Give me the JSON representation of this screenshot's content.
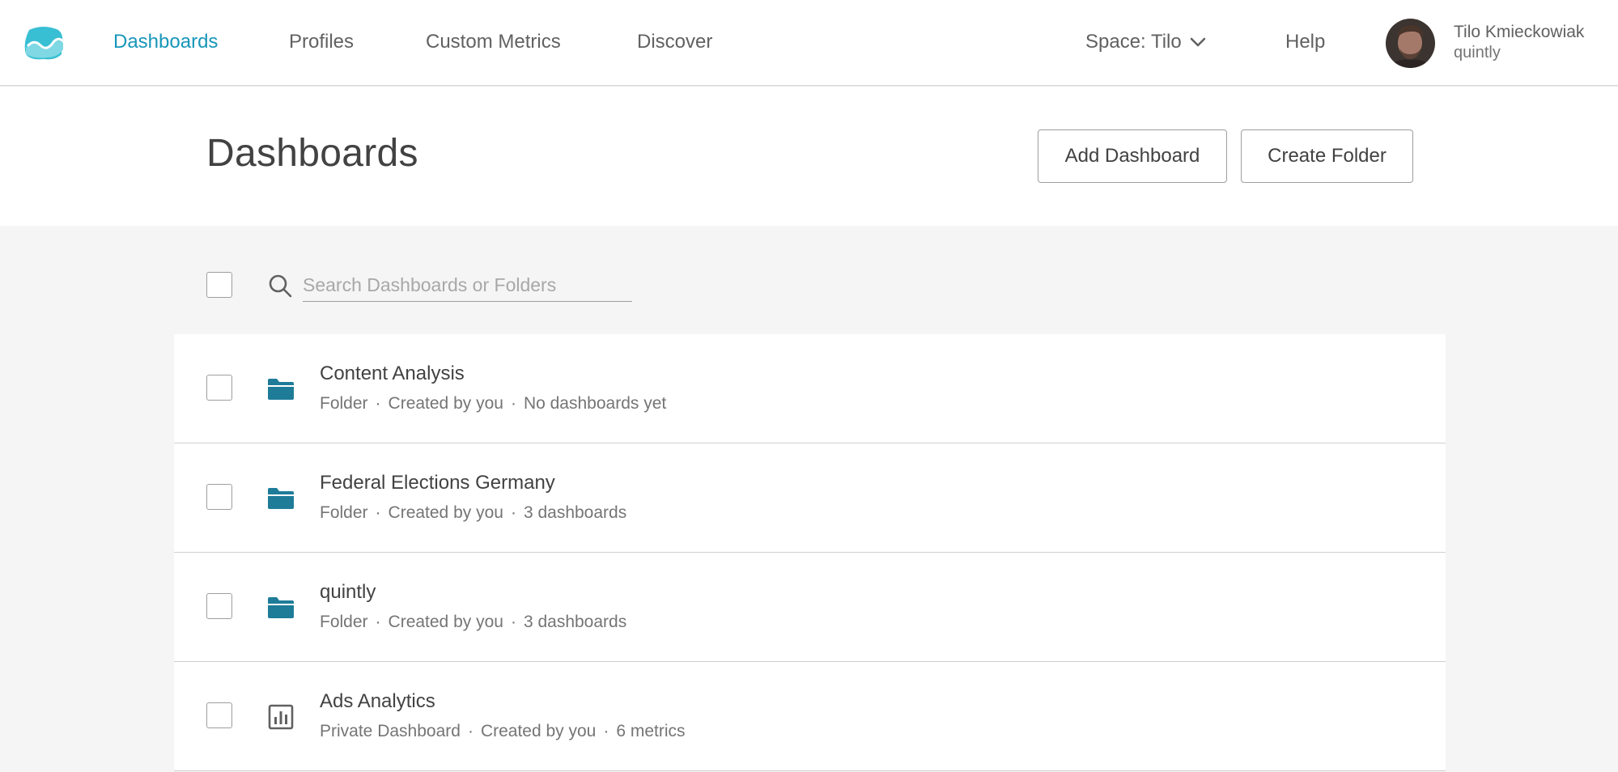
{
  "nav": {
    "logo_icon": "quintly-logo-icon",
    "links": [
      {
        "label": "Dashboards",
        "active": true
      },
      {
        "label": "Profiles",
        "active": false
      },
      {
        "label": "Custom Metrics",
        "active": false
      },
      {
        "label": "Discover",
        "active": false
      }
    ],
    "space_label": "Space: Tilo",
    "space_icon": "chevron-down-icon",
    "help_label": "Help",
    "user": {
      "name": "Tilo Kmieckowiak",
      "org": "quintly"
    }
  },
  "header": {
    "title": "Dashboards",
    "add_dashboard_label": "Add Dashboard",
    "create_folder_label": "Create Folder"
  },
  "search": {
    "placeholder": "Search Dashboards or Folders",
    "value": ""
  },
  "items": [
    {
      "icon": "folder-icon",
      "title": "Content Analysis",
      "meta": [
        "Folder",
        "Created by you",
        "No dashboards yet"
      ]
    },
    {
      "icon": "folder-icon",
      "title": "Federal Elections Germany",
      "meta": [
        "Folder",
        "Created by you",
        "3 dashboards"
      ]
    },
    {
      "icon": "folder-icon",
      "title": "quintly",
      "meta": [
        "Folder",
        "Created by you",
        "3 dashboards"
      ]
    },
    {
      "icon": "dashboard-icon",
      "title": "Ads Analytics",
      "meta": [
        "Private Dashboard",
        "Created by you",
        "6 metrics"
      ]
    }
  ],
  "colors": {
    "accent": "#1896b9",
    "folder": "#1f7c99",
    "text": "#424242",
    "muted": "#757575",
    "background": "#f5f5f5"
  }
}
